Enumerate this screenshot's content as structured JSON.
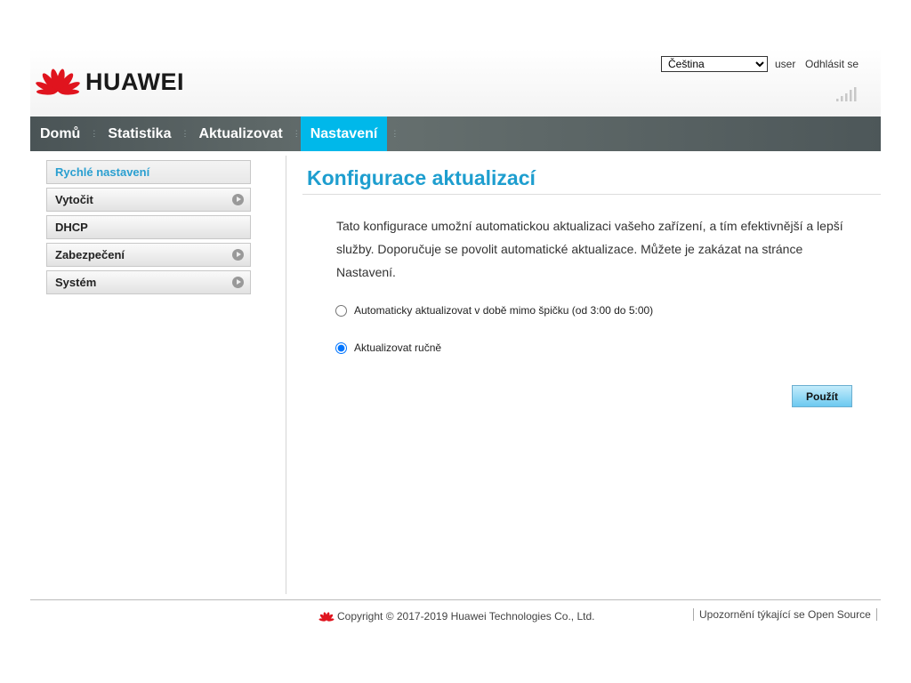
{
  "header": {
    "brand": "HUAWEI",
    "language": "Čeština",
    "user": "user",
    "logout": "Odhlásit se",
    "signal_icon": "signal-bars-icon"
  },
  "nav": {
    "items": [
      {
        "label": "Domů"
      },
      {
        "label": "Statistika"
      },
      {
        "label": "Aktualizovat"
      },
      {
        "label": "Nastavení",
        "active": true
      }
    ]
  },
  "sidebar": {
    "items": [
      {
        "label": "Rychlé nastavení",
        "active": true
      },
      {
        "label": "Vytočit",
        "arrow": true
      },
      {
        "label": "DHCP"
      },
      {
        "label": "Zabezpečení",
        "arrow": true
      },
      {
        "label": "Systém",
        "arrow": true
      }
    ]
  },
  "main": {
    "title": "Konfigurace aktualizací",
    "description": "Tato konfigurace umožní automatickou aktualizaci vašeho zařízení, a tím efektivnější a lepší služby. Doporučuje se povolit automatické aktualizace. Můžete je zakázat na stránce Nastavení.",
    "options": [
      {
        "label": "Automaticky aktualizovat v době mimo špičku (od 3:00 do 5:00)",
        "checked": false
      },
      {
        "label": "Aktualizovat ručně",
        "checked": true
      }
    ],
    "apply": "Použít"
  },
  "footer": {
    "copyright": "Copyright © 2017-2019 Huawei Technologies Co., Ltd.",
    "open_source": "Upozornění týkající se Open Source"
  },
  "colors": {
    "accent": "#00b8ea",
    "title": "#1e9ecf",
    "brand_red": "#e0141e"
  }
}
